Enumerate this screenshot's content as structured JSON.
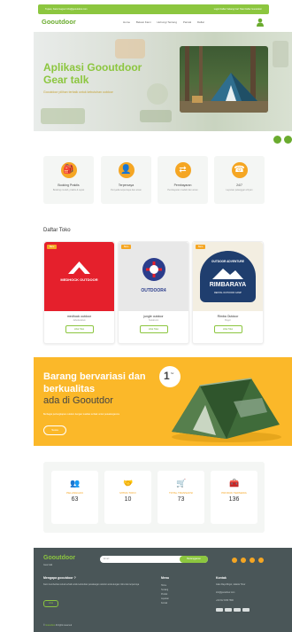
{
  "topbar": {
    "left_text": "Tujuan, Kami Gogoor  info@gooutdoor.com",
    "right_text": "Login  Daftar  Cabang  Cari Toko  Daftar Gooutdoor"
  },
  "nav": {
    "logo": "Gooutdoor",
    "links": [
      "Home",
      "Bekasi Kami",
      "Hubungi Tentang",
      "Parsial",
      "Daftar"
    ]
  },
  "hero": {
    "title": "Aplikasi Gooutdoor Gear talk",
    "subtitle": "Gooutdoor pilihan terbaik untuk kebutuhan outdoor"
  },
  "features": [
    {
      "icon": "backpack-icon",
      "glyph": "🎒",
      "title": "Booking Praktis",
      "desc": "Booking mudah, praktis & cepat"
    },
    {
      "icon": "user-icon",
      "glyph": "👤",
      "title": "Terpercaya",
      "desc": "Penyedia terpercaya dan aman"
    },
    {
      "icon": "exchange-icon",
      "glyph": "⇄",
      "title": "Pembayaran",
      "desc": "Pembayaran mudah dan aman"
    },
    {
      "icon": "phone-icon",
      "glyph": "☎",
      "title": "24/7",
      "desc": "Layanan pelanggan 24 jam"
    }
  ],
  "shops": {
    "title": "Daftar Toko",
    "items": [
      {
        "badge": "Baru",
        "logo_text": "MEDHOCK OUTDOOR",
        "name": "medhock outdoor",
        "city": "Jabodetabek",
        "button": "Lihat Toko"
      },
      {
        "badge": "Baru",
        "logo_text": "OUTDOOR4",
        "name": "jungle outdoor",
        "city": "Sukabumi",
        "button": "Lihat Toko"
      },
      {
        "badge": "Baru",
        "logo_text": "RIMBARAYA",
        "logo_top": "OUTDOOR ADVENTURE",
        "logo_bottom": "RENTAL OUTDOOR CAMP",
        "name": "Rimba Outdoor",
        "city": "Bogor",
        "button": "Lihat Toko"
      }
    ]
  },
  "promo": {
    "heading": "Barang bervariasi dan berkualitas",
    "subheading": "ada di Gooutdor",
    "text": "Berbagai perlengkapan outdoor dengan kualitas terbaik untuk petualanganmu",
    "button": "Sewa",
    "badge_number": "1",
    "badge_suffix": "for"
  },
  "stats": [
    {
      "icon": "people-icon",
      "glyph": "👥",
      "label": "PELANGGAN",
      "value": "63"
    },
    {
      "icon": "handshake-icon",
      "glyph": "🤝",
      "label": "MITRA TOKO",
      "value": "10"
    },
    {
      "icon": "cart-icon",
      "glyph": "🛒",
      "label": "TOTAL TRANSAKSI",
      "value": "73"
    },
    {
      "icon": "box-icon",
      "glyph": "🧰",
      "label": "PRODUK TERSEDIA",
      "value": "136"
    }
  ],
  "footer": {
    "logo": "Gooutdoor",
    "tagline": "Gear talk",
    "subscribe_placeholder": "Email",
    "subscribe_button": "Berlangganan",
    "about_title": "Mengapa gooutdoor ?",
    "about_text": "Kami memberikan solusi terbaik untuk kebutuhan petualangan outdoor anda dengan mitra toko terpercaya",
    "about_button": "Lihat",
    "menu_title": "Menu",
    "menu_items": [
      "Home",
      "Tentang",
      "Produk",
      "Layanan",
      "Kontak"
    ],
    "contact_title": "Kontak",
    "contact_lines": [
      "Jalan Raya Bogor, Jakarta Timur",
      "info@gooutdoor.com",
      "+62 812 3456 7890"
    ],
    "copyright_brand": "Gooutdoor",
    "copyright_text": "All rights reserved"
  },
  "colors": {
    "brand_green": "#8cc63f",
    "accent_orange": "#f5a623",
    "promo_yellow": "#fbb829",
    "footer_bg": "#4a5658"
  }
}
